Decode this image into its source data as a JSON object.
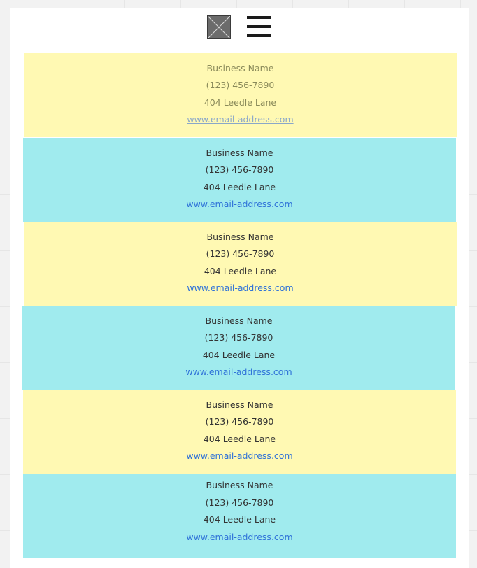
{
  "header": {
    "image_placeholder_icon": "image-placeholder-icon",
    "menu_icon": "hamburger-menu-icon"
  },
  "cards": [
    {
      "name": "Business Name",
      "phone": "(123) 456-7890",
      "address": "404 Leedle Lane",
      "website": "www.email-address.com",
      "color": "#fff9b3"
    },
    {
      "name": "Business Name",
      "phone": "(123) 456-7890",
      "address": "404 Leedle Lane",
      "website": "www.email-address.com",
      "color": "#a0ebee"
    },
    {
      "name": "Business Name",
      "phone": "(123) 456-7890",
      "address": "404 Leedle Lane",
      "website": "www.email-address.com",
      "color": "#fff9b3"
    },
    {
      "name": "Business Name",
      "phone": "(123) 456-7890",
      "address": "404 Leedle Lane",
      "website": "www.email-address.com",
      "color": "#a0ebee"
    },
    {
      "name": "Business Name",
      "phone": "(123) 456-7890",
      "address": "404 Leedle Lane",
      "website": "www.email-address.com",
      "color": "#fff9b3"
    },
    {
      "name": "Business Name",
      "phone": "(123) 456-7890",
      "address": "404 Leedle Lane",
      "website": "www.email-address.com",
      "color": "#a0ebee"
    }
  ],
  "colors": {
    "yellow": "#fff9b3",
    "cyan": "#a0ebee",
    "link": "#2f72d8"
  }
}
